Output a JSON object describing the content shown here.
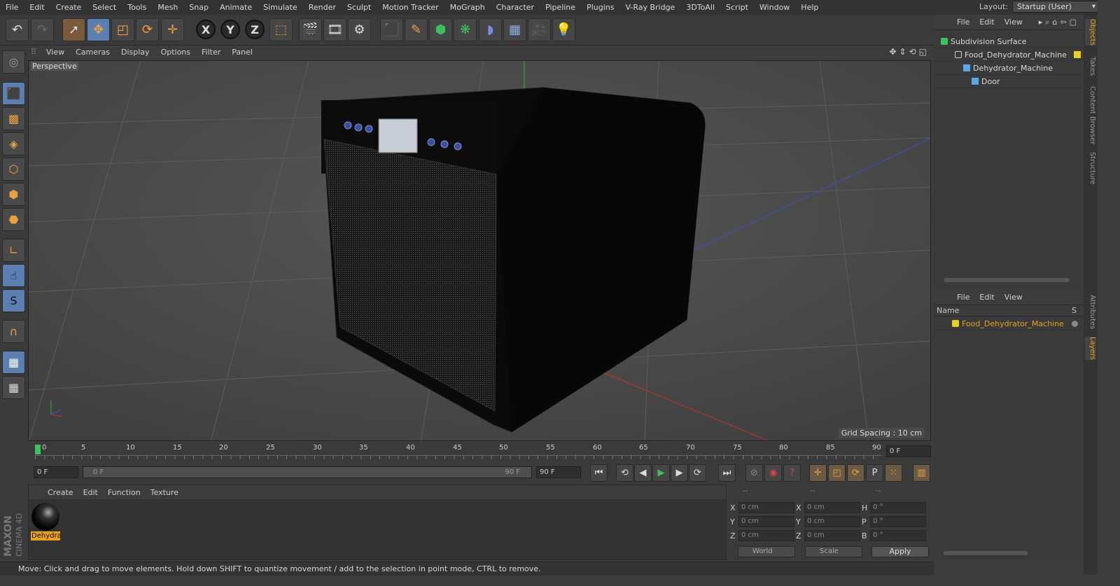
{
  "menubar": {
    "items": [
      "File",
      "Edit",
      "Create",
      "Select",
      "Tools",
      "Mesh",
      "Snap",
      "Animate",
      "Simulate",
      "Render",
      "Sculpt",
      "Motion Tracker",
      "MoGraph",
      "Character",
      "Pipeline",
      "Plugins",
      "V-Ray Bridge",
      "3DToAll",
      "Script",
      "Window",
      "Help"
    ],
    "layout_label": "Layout:",
    "layout_value": "Startup (User)"
  },
  "toolbar": {
    "axis_x": "X",
    "axis_y": "Y",
    "axis_z": "Z"
  },
  "viewport": {
    "menu": [
      "View",
      "Cameras",
      "Display",
      "Options",
      "Filter",
      "Panel"
    ],
    "label": "Perspective",
    "grid_spacing": "Grid Spacing : 10 cm"
  },
  "timeline": {
    "ticks": [
      "0",
      "5",
      "10",
      "15",
      "20",
      "25",
      "30",
      "35",
      "40",
      "45",
      "50",
      "55",
      "60",
      "65",
      "70",
      "75",
      "80",
      "85",
      "90"
    ],
    "current_frame": "0 F"
  },
  "playback": {
    "start_field": "0 F",
    "slider_start": "0 F",
    "slider_end": "90 F",
    "end_field": "90 F"
  },
  "material_manager": {
    "menu": [
      "Create",
      "Edit",
      "Function",
      "Texture"
    ],
    "material_name": "Dehydra"
  },
  "coordinates": {
    "header_a": "--",
    "header_b": "--",
    "header_c": "--",
    "rows": [
      {
        "a_label": "X",
        "a_val": "0 cm",
        "b_label": "X",
        "b_val": "0 cm",
        "c_label": "H",
        "c_val": "0 °"
      },
      {
        "a_label": "Y",
        "a_val": "0 cm",
        "b_label": "Y",
        "b_val": "0 cm",
        "c_label": "P",
        "c_val": "0 °"
      },
      {
        "a_label": "Z",
        "a_val": "0 cm",
        "b_label": "Z",
        "b_val": "0 cm",
        "c_label": "B",
        "c_val": "0 °"
      }
    ],
    "space": "World",
    "mode": "Scale",
    "apply": "Apply"
  },
  "status": "Move: Click and drag to move elements. Hold down SHIFT to quantize movement / add to the selection in point mode, CTRL to remove.",
  "objects_panel": {
    "menu": [
      "File",
      "Edit",
      "View"
    ],
    "items": [
      "Subdivision Surface",
      "Food_Dehydrator_Machine",
      "Dehydrator_Machine",
      "Door"
    ]
  },
  "layers_panel": {
    "menu": [
      "File",
      "Edit",
      "View"
    ],
    "col_name": "Name",
    "col_s": "S",
    "layer": "Food_Dehydrator_Machine"
  },
  "side_tabs": [
    "Objects",
    "Takes",
    "Content Browser",
    "Structure",
    "Attributes",
    "Layers"
  ],
  "brand": {
    "maxon": "MAXON",
    "product": "CINEMA 4D"
  },
  "colors": {
    "accent": "#e8a020",
    "active_tool": "#5b7fb0"
  }
}
